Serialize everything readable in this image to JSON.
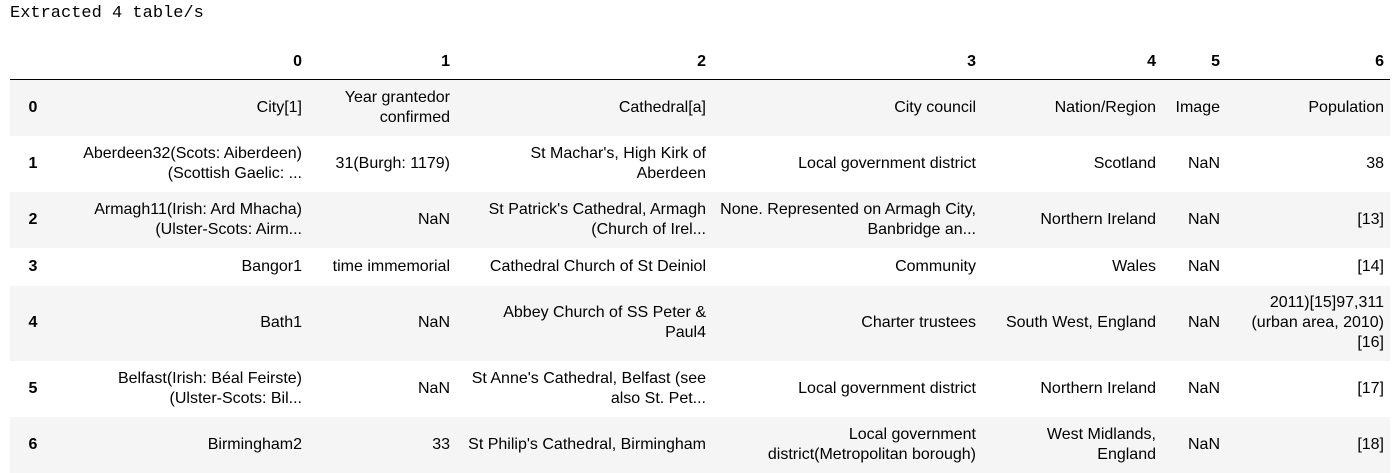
{
  "output": {
    "text": "Extracted 4 table/s"
  },
  "table": {
    "columns": [
      "",
      "0",
      "1",
      "2",
      "3",
      "4",
      "5",
      "6"
    ],
    "rows": [
      {
        "index": "0",
        "cells": [
          "City[1]",
          "Year grantedor confirmed",
          "Cathedral[a]",
          "City council",
          "Nation/Region",
          "Image",
          "Population"
        ]
      },
      {
        "index": "1",
        "cells": [
          "Aberdeen32(Scots: Aiberdeen) (Scottish Gaelic: ...",
          "31(Burgh: 1179)",
          "St Machar's, High Kirk of Aberdeen",
          "Local government district",
          "Scotland",
          "NaN",
          "38"
        ]
      },
      {
        "index": "2",
        "cells": [
          "Armagh11(Irish: Ard Mhacha) (Ulster-Scots: Airm...",
          "NaN",
          "St Patrick's Cathedral, Armagh (Church of Irel...",
          "None. Represented on Armagh City, Banbridge an...",
          "Northern Ireland",
          "NaN",
          "[13]"
        ]
      },
      {
        "index": "3",
        "cells": [
          "Bangor1",
          "time immemorial",
          "Cathedral Church of St Deiniol",
          "Community",
          "Wales",
          "NaN",
          "[14]"
        ]
      },
      {
        "index": "4",
        "cells": [
          "Bath1",
          "NaN",
          "Abbey Church of SS Peter & Paul4",
          "Charter trustees",
          "South West, England",
          "NaN",
          "2011)[15]97,311 (urban area, 2010) [16]"
        ]
      },
      {
        "index": "5",
        "cells": [
          "Belfast(Irish: Béal Feirste) (Ulster-Scots: Bil...",
          "NaN",
          "St Anne's Cathedral, Belfast (see also St. Pet...",
          "Local government district",
          "Northern Ireland",
          "NaN",
          "[17]"
        ]
      },
      {
        "index": "6",
        "cells": [
          "Birmingham2",
          "33",
          "St Philip's Cathedral, Birmingham",
          "Local government district(Metropolitan borough)",
          "West Midlands, England",
          "NaN",
          "[18]"
        ]
      }
    ]
  }
}
